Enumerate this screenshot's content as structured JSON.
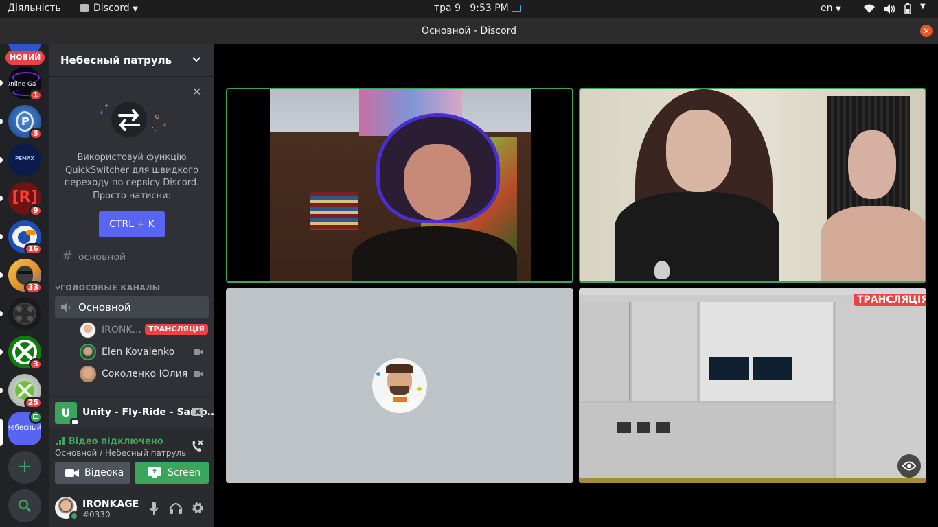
{
  "system_bar": {
    "activities": "Діяльність",
    "app_name": "Discord",
    "date": "тра 9",
    "time": "9:53 PM",
    "language": "en"
  },
  "window": {
    "title": "Основной - Discord"
  },
  "servers": {
    "new_label": "НОВИЙ",
    "items": [
      {
        "name": "online-games",
        "text": "Online Ga",
        "badge": "1"
      },
      {
        "name": "playstation",
        "badge": "3"
      },
      {
        "name": "pemax",
        "text": "PEMAX",
        "badge": ""
      },
      {
        "name": "r-server",
        "text": "[R]",
        "badge": "9"
      },
      {
        "name": "server-blue",
        "badge": "16"
      },
      {
        "name": "server-avatar",
        "badge": "33"
      },
      {
        "name": "server-gamepad",
        "badge": ""
      },
      {
        "name": "xbox",
        "badge": "3"
      },
      {
        "name": "xbox-360",
        "badge": "25"
      },
      {
        "name": "selected-server",
        "text": "Небесныйпатр"
      }
    ]
  },
  "sidebar": {
    "server_name": "Небесный патруль",
    "promo": {
      "text": "Використовуй функцію QuickSwitcher для швидкого переходу по сервісу Discord. Просто натисни:",
      "shortcut": "CTRL + K"
    },
    "text_channel": "основной",
    "voice_category": "ГОЛОСОВЫЕ КАНАЛЫ",
    "voice_channel": "Основной",
    "voice_users": [
      {
        "name": "IRONK...",
        "live": "ТРАНСЛЯЦІЯ"
      },
      {
        "name": "Elen Kovalenko"
      },
      {
        "name": "Соколенко Юлия"
      }
    ]
  },
  "activity": {
    "name": "Unity - Fly-Ride - Samp..."
  },
  "voice_panel": {
    "status": "Відео підключено",
    "location": "Основной / Небесный патруль",
    "video_button": "Відеока",
    "screen_button": "Screen"
  },
  "user": {
    "name": "IRONKAGE",
    "tag": "#0330"
  },
  "stream": {
    "live_label": "ТРАНСЛЯЦІЯ"
  },
  "colors": {
    "blurple": "#5865f2",
    "green": "#3ba55d",
    "red": "#ed4245",
    "speaking": "#3ba55d"
  }
}
